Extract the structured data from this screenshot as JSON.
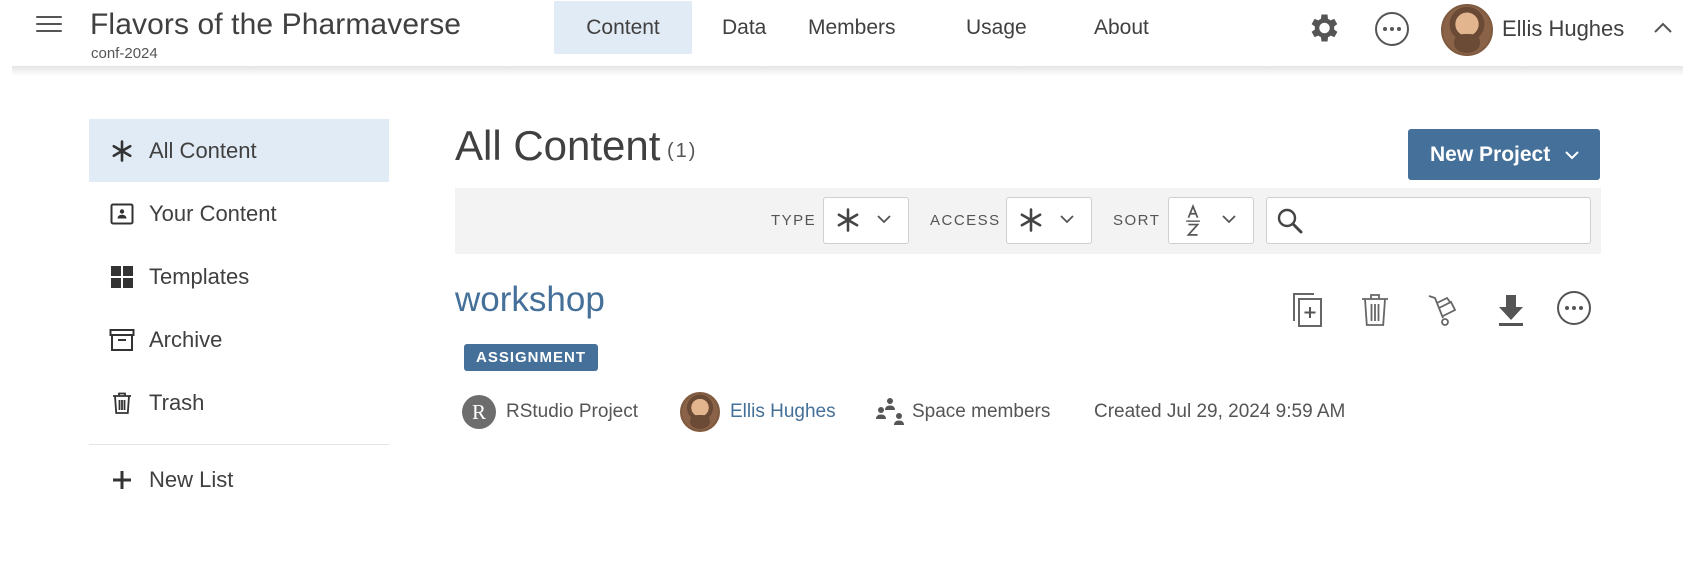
{
  "header": {
    "space_title": "Flavors of the Pharmaverse",
    "space_subtitle": "conf-2024",
    "tabs": [
      {
        "label": "Content"
      },
      {
        "label": "Data"
      },
      {
        "label": "Members"
      },
      {
        "label": "Usage"
      },
      {
        "label": "About"
      }
    ],
    "active_tab": "Content",
    "user_name": "Ellis Hughes"
  },
  "sidebar": {
    "items": [
      {
        "label": "All Content",
        "icon": "asterisk-icon"
      },
      {
        "label": "Your Content",
        "icon": "user-badge-icon"
      },
      {
        "label": "Templates",
        "icon": "grid-icon"
      },
      {
        "label": "Archive",
        "icon": "archive-box-icon"
      },
      {
        "label": "Trash",
        "icon": "trash-icon"
      }
    ],
    "new_list_label": "New List",
    "active_item": "All Content"
  },
  "main": {
    "title": "All Content",
    "count": "(1)",
    "new_project_label": "New Project",
    "filters": {
      "type_label": "TYPE",
      "access_label": "ACCESS",
      "sort_label": "SORT",
      "sort_value": "A-Z",
      "search_value": ""
    },
    "items": [
      {
        "title": "workshop",
        "badge": "ASSIGNMENT",
        "project_type": "RStudio Project",
        "project_type_initial": "R",
        "owner": "Ellis Hughes",
        "access": "Space members",
        "created": "Created Jul 29, 2024 9:59 AM",
        "actions": [
          "copy-icon",
          "trash-icon",
          "move-icon",
          "download-icon",
          "more-icon"
        ]
      }
    ]
  },
  "colors": {
    "accent": "#447099",
    "active_bg": "#e1ebf5",
    "filter_bg": "#f3f3f3",
    "text": "#404040"
  }
}
